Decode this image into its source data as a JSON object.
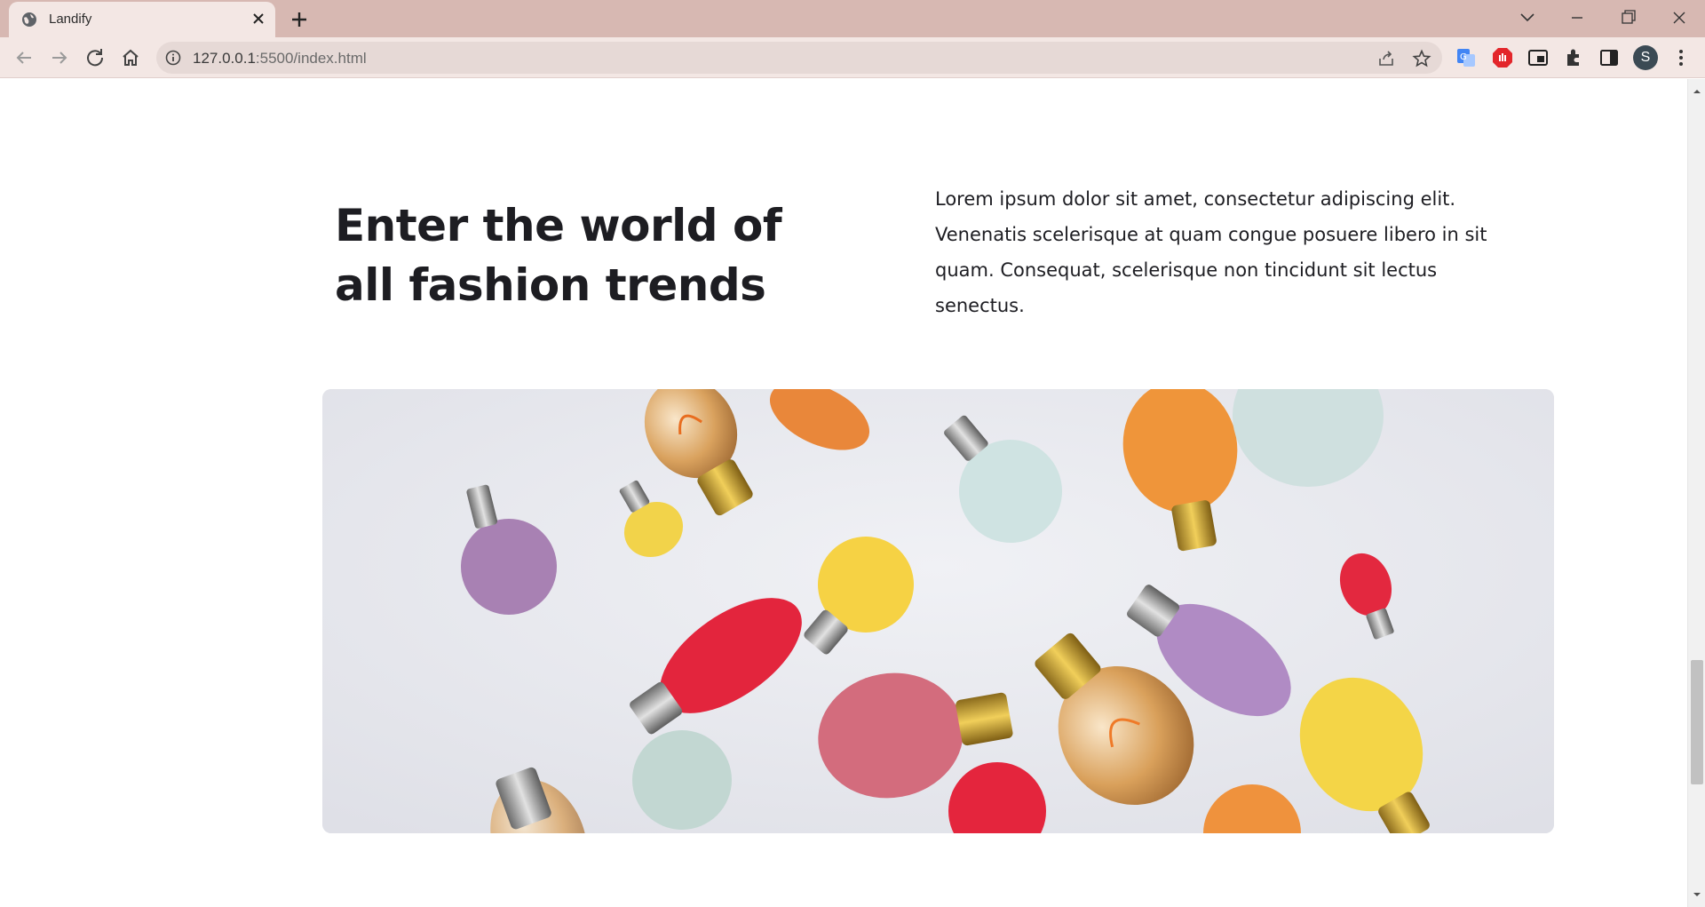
{
  "browser": {
    "tab": {
      "title": "Landify"
    },
    "address_bar": {
      "url_host": "127.0.0.1",
      "url_path": ":5500/index.html"
    },
    "profile_initial": "S",
    "icons": [
      "globe-icon",
      "close-icon",
      "plus-icon",
      "chevron-down-icon",
      "minimize-icon",
      "restore-icon",
      "window-close-icon",
      "back-arrow-icon",
      "forward-arrow-icon",
      "reload-icon",
      "home-icon",
      "info-icon",
      "share-icon",
      "star-icon",
      "translate-icon",
      "adblock-icon",
      "picture-in-picture-icon",
      "extensions-icon",
      "side-panel-icon",
      "menu-dots-icon"
    ]
  },
  "page": {
    "heading": "Enter the world of all fashion trends",
    "paragraph": "Lorem ipsum dolor sit amet, consectetur adipiscing elit. Venenatis scelerisque at quam congue posuere libero in sit quam. Consequat, scelerisque non tincidunt sit lectus senectus."
  },
  "colors": {
    "chrome_tabbar": "#d7b8b2",
    "chrome_toolbar": "#f3e7e4",
    "text_dark": "#1d1d22",
    "page_bg": "#ffffff"
  }
}
